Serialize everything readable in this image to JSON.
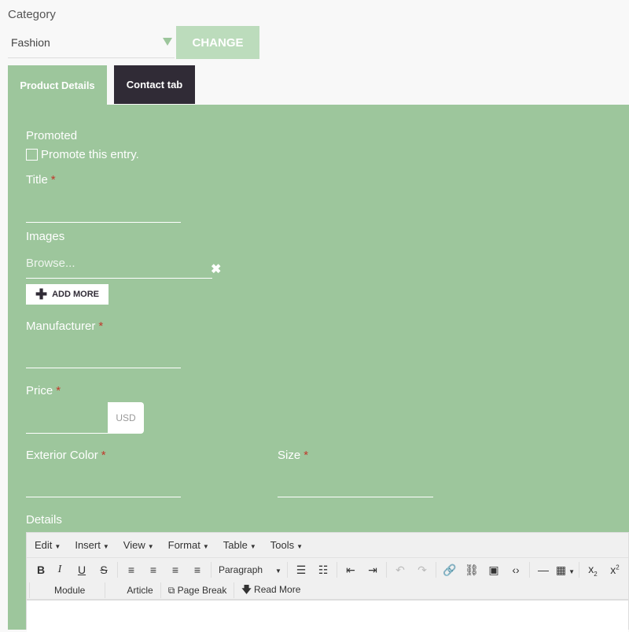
{
  "category": {
    "label": "Category",
    "value": "Fashion",
    "change_label": "CHANGE"
  },
  "tabs": [
    {
      "label": "Product Details",
      "active": true
    },
    {
      "label": "Contact tab",
      "active": false
    }
  ],
  "form": {
    "promoted_label": "Promoted",
    "promote_checkbox": "Promote this entry.",
    "promote_checked": false,
    "title_label": "Title",
    "required_mark": "*",
    "images_label": "Images",
    "browse_placeholder": "Browse...",
    "add_more_label": "ADD MORE",
    "manufacturer_label": "Manufacturer",
    "price_label": "Price",
    "currency": "USD",
    "exterior_color_label": "Exterior Color",
    "size_label": "Size",
    "details_label": "Details"
  },
  "editor": {
    "menu": [
      "Edit",
      "Insert",
      "View",
      "Format",
      "Table",
      "Tools"
    ],
    "format_select": "Paragraph",
    "row2": {
      "module": "Module",
      "article": "Article",
      "page_break": "Page Break",
      "read_more": "Read More"
    }
  },
  "colors": {
    "panel": "#9dc69c",
    "dark_tab": "#302b36",
    "required": "#c0392b"
  }
}
